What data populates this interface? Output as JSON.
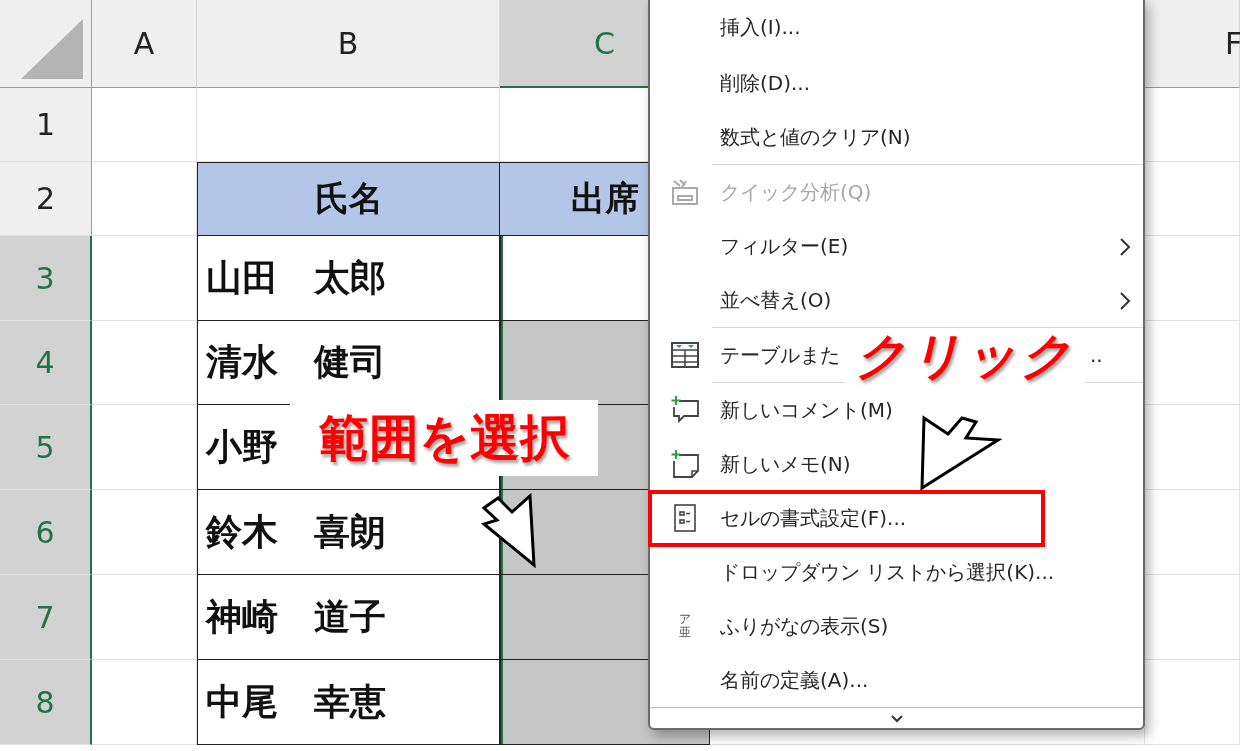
{
  "columns": [
    {
      "label": "A",
      "selected": false
    },
    {
      "label": "B",
      "selected": false
    },
    {
      "label": "C",
      "selected": true
    },
    {
      "label": "F",
      "selected": false
    }
  ],
  "rows": [
    {
      "number": "1",
      "selected": false,
      "kind": "blank"
    },
    {
      "number": "2",
      "selected": false,
      "kind": "heading",
      "cells": [
        "氏名",
        "出席"
      ]
    },
    {
      "number": "3",
      "selected": true,
      "kind": "data",
      "name": "山田　太郎",
      "active": true
    },
    {
      "number": "4",
      "selected": true,
      "kind": "data",
      "name": "清水　健司",
      "active": false
    },
    {
      "number": "5",
      "selected": true,
      "kind": "data",
      "name": "小野",
      "active": false
    },
    {
      "number": "6",
      "selected": true,
      "kind": "data",
      "name": "鈴木　喜朗",
      "active": false
    },
    {
      "number": "7",
      "selected": true,
      "kind": "data",
      "name": "神崎　道子",
      "active": false
    },
    {
      "number": "8",
      "selected": true,
      "kind": "data",
      "name": "中尾　幸恵",
      "active": false
    }
  ],
  "context_menu": {
    "items": [
      {
        "kind": "plain",
        "label": "挿入(I)...",
        "disabled": false,
        "submenu": false,
        "highlighted": false
      },
      {
        "kind": "plain",
        "label": "削除(D)...",
        "disabled": false,
        "submenu": false,
        "highlighted": false
      },
      {
        "kind": "plain",
        "label": "数式と値のクリア(N)",
        "disabled": false,
        "submenu": false,
        "highlighted": false
      },
      {
        "kind": "separator"
      },
      {
        "kind": "analysis",
        "label": "クイック分析(Q)",
        "disabled": true,
        "submenu": false,
        "highlighted": false
      },
      {
        "kind": "plain",
        "label": "フィルター(E)",
        "disabled": false,
        "submenu": true,
        "highlighted": false
      },
      {
        "kind": "plain",
        "label": "並べ替え(O)",
        "disabled": false,
        "submenu": true,
        "highlighted": false
      },
      {
        "kind": "separator"
      },
      {
        "kind": "table",
        "label": "テーブルまた",
        "trailing": "..",
        "disabled": false,
        "submenu": false,
        "highlighted": false
      },
      {
        "kind": "separator"
      },
      {
        "kind": "comment",
        "label": "新しいコメント(M)",
        "disabled": false,
        "submenu": false,
        "highlighted": false
      },
      {
        "kind": "note",
        "label": "新しいメモ(N)",
        "disabled": false,
        "submenu": false,
        "highlighted": false
      },
      {
        "kind": "format",
        "label": "セルの書式設定(F)...",
        "disabled": false,
        "submenu": false,
        "highlighted": true
      },
      {
        "kind": "plain",
        "label": "ドロップダウン リストから選択(K)...",
        "disabled": false,
        "submenu": false,
        "highlighted": false
      },
      {
        "kind": "furigana",
        "label": "ふりがなの表示(S)",
        "icon_text": [
          "ア",
          "亜"
        ],
        "disabled": false,
        "submenu": false,
        "highlighted": false
      },
      {
        "kind": "plain",
        "label": "名前の定義(A)...",
        "disabled": false,
        "submenu": false,
        "highlighted": false
      }
    ]
  },
  "callouts": [
    {
      "text": "範囲を選択"
    },
    {
      "text": "クリック"
    }
  ]
}
